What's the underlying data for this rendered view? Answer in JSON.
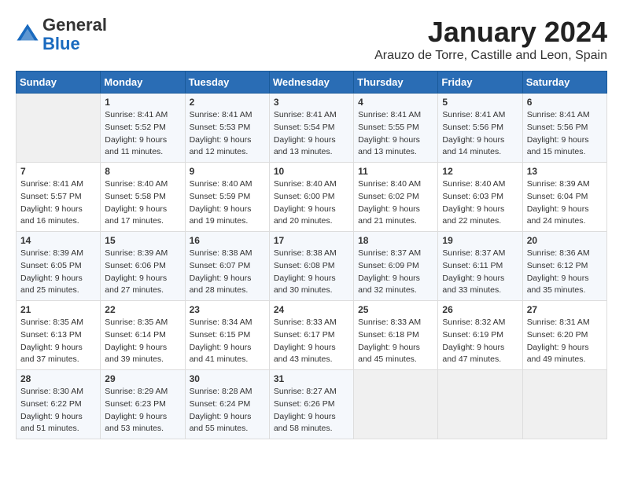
{
  "header": {
    "logo_general": "General",
    "logo_blue": "Blue",
    "month_title": "January 2024",
    "location": "Arauzo de Torre, Castille and Leon, Spain"
  },
  "calendar": {
    "days_of_week": [
      "Sunday",
      "Monday",
      "Tuesday",
      "Wednesday",
      "Thursday",
      "Friday",
      "Saturday"
    ],
    "weeks": [
      [
        {
          "day": "",
          "info": ""
        },
        {
          "day": "1",
          "info": "Sunrise: 8:41 AM\nSunset: 5:52 PM\nDaylight: 9 hours\nand 11 minutes."
        },
        {
          "day": "2",
          "info": "Sunrise: 8:41 AM\nSunset: 5:53 PM\nDaylight: 9 hours\nand 12 minutes."
        },
        {
          "day": "3",
          "info": "Sunrise: 8:41 AM\nSunset: 5:54 PM\nDaylight: 9 hours\nand 13 minutes."
        },
        {
          "day": "4",
          "info": "Sunrise: 8:41 AM\nSunset: 5:55 PM\nDaylight: 9 hours\nand 13 minutes."
        },
        {
          "day": "5",
          "info": "Sunrise: 8:41 AM\nSunset: 5:56 PM\nDaylight: 9 hours\nand 14 minutes."
        },
        {
          "day": "6",
          "info": "Sunrise: 8:41 AM\nSunset: 5:56 PM\nDaylight: 9 hours\nand 15 minutes."
        }
      ],
      [
        {
          "day": "7",
          "info": "Sunrise: 8:41 AM\nSunset: 5:57 PM\nDaylight: 9 hours\nand 16 minutes."
        },
        {
          "day": "8",
          "info": "Sunrise: 8:40 AM\nSunset: 5:58 PM\nDaylight: 9 hours\nand 17 minutes."
        },
        {
          "day": "9",
          "info": "Sunrise: 8:40 AM\nSunset: 5:59 PM\nDaylight: 9 hours\nand 19 minutes."
        },
        {
          "day": "10",
          "info": "Sunrise: 8:40 AM\nSunset: 6:00 PM\nDaylight: 9 hours\nand 20 minutes."
        },
        {
          "day": "11",
          "info": "Sunrise: 8:40 AM\nSunset: 6:02 PM\nDaylight: 9 hours\nand 21 minutes."
        },
        {
          "day": "12",
          "info": "Sunrise: 8:40 AM\nSunset: 6:03 PM\nDaylight: 9 hours\nand 22 minutes."
        },
        {
          "day": "13",
          "info": "Sunrise: 8:39 AM\nSunset: 6:04 PM\nDaylight: 9 hours\nand 24 minutes."
        }
      ],
      [
        {
          "day": "14",
          "info": "Sunrise: 8:39 AM\nSunset: 6:05 PM\nDaylight: 9 hours\nand 25 minutes."
        },
        {
          "day": "15",
          "info": "Sunrise: 8:39 AM\nSunset: 6:06 PM\nDaylight: 9 hours\nand 27 minutes."
        },
        {
          "day": "16",
          "info": "Sunrise: 8:38 AM\nSunset: 6:07 PM\nDaylight: 9 hours\nand 28 minutes."
        },
        {
          "day": "17",
          "info": "Sunrise: 8:38 AM\nSunset: 6:08 PM\nDaylight: 9 hours\nand 30 minutes."
        },
        {
          "day": "18",
          "info": "Sunrise: 8:37 AM\nSunset: 6:09 PM\nDaylight: 9 hours\nand 32 minutes."
        },
        {
          "day": "19",
          "info": "Sunrise: 8:37 AM\nSunset: 6:11 PM\nDaylight: 9 hours\nand 33 minutes."
        },
        {
          "day": "20",
          "info": "Sunrise: 8:36 AM\nSunset: 6:12 PM\nDaylight: 9 hours\nand 35 minutes."
        }
      ],
      [
        {
          "day": "21",
          "info": "Sunrise: 8:35 AM\nSunset: 6:13 PM\nDaylight: 9 hours\nand 37 minutes."
        },
        {
          "day": "22",
          "info": "Sunrise: 8:35 AM\nSunset: 6:14 PM\nDaylight: 9 hours\nand 39 minutes."
        },
        {
          "day": "23",
          "info": "Sunrise: 8:34 AM\nSunset: 6:15 PM\nDaylight: 9 hours\nand 41 minutes."
        },
        {
          "day": "24",
          "info": "Sunrise: 8:33 AM\nSunset: 6:17 PM\nDaylight: 9 hours\nand 43 minutes."
        },
        {
          "day": "25",
          "info": "Sunrise: 8:33 AM\nSunset: 6:18 PM\nDaylight: 9 hours\nand 45 minutes."
        },
        {
          "day": "26",
          "info": "Sunrise: 8:32 AM\nSunset: 6:19 PM\nDaylight: 9 hours\nand 47 minutes."
        },
        {
          "day": "27",
          "info": "Sunrise: 8:31 AM\nSunset: 6:20 PM\nDaylight: 9 hours\nand 49 minutes."
        }
      ],
      [
        {
          "day": "28",
          "info": "Sunrise: 8:30 AM\nSunset: 6:22 PM\nDaylight: 9 hours\nand 51 minutes."
        },
        {
          "day": "29",
          "info": "Sunrise: 8:29 AM\nSunset: 6:23 PM\nDaylight: 9 hours\nand 53 minutes."
        },
        {
          "day": "30",
          "info": "Sunrise: 8:28 AM\nSunset: 6:24 PM\nDaylight: 9 hours\nand 55 minutes."
        },
        {
          "day": "31",
          "info": "Sunrise: 8:27 AM\nSunset: 6:26 PM\nDaylight: 9 hours\nand 58 minutes."
        },
        {
          "day": "",
          "info": ""
        },
        {
          "day": "",
          "info": ""
        },
        {
          "day": "",
          "info": ""
        }
      ]
    ]
  }
}
